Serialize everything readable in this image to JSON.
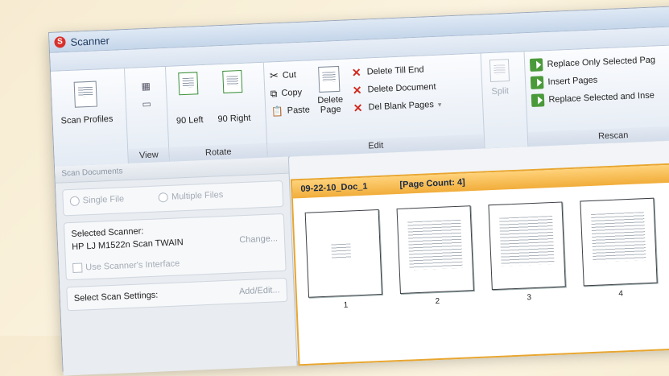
{
  "window": {
    "title": "Scanner"
  },
  "ribbon": {
    "groups": {
      "scan_profiles": {
        "button": "Scan Profiles"
      },
      "view": {
        "label": "View"
      },
      "rotate": {
        "label": "Rotate",
        "left": "90 Left",
        "right": "90 Right"
      },
      "edit": {
        "label": "Edit",
        "cut": "Cut",
        "copy": "Copy",
        "paste": "Paste",
        "delete_page_line1": "Delete",
        "delete_page_line2": "Page",
        "delete_till_end": "Delete Till End",
        "delete_document": "Delete Document",
        "del_blank_pages": "Del Blank Pages"
      },
      "split": {
        "button": "Split"
      },
      "rescan": {
        "label": "Rescan",
        "replace_only_selected": "Replace Only Selected Pag",
        "insert_pages": "Insert Pages",
        "replace_selected_and_insert": "Replace Selected and Inse"
      }
    }
  },
  "left_panel": {
    "header": "Scan Documents",
    "single_file": "Single File",
    "multiple_files": "Multiple Files",
    "selected_scanner_label": "Selected Scanner:",
    "selected_scanner_value": "HP LJ M1522n Scan TWAIN",
    "change_link": "Change...",
    "use_interface": "Use Scanner's Interface",
    "select_settings_label": "Select Scan Settings:",
    "add_edit_link": "Add/Edit..."
  },
  "document": {
    "name": "09-22-10_Doc_1",
    "page_count": "[Page Count: 4]",
    "pages": [
      "1",
      "2",
      "3",
      "4"
    ]
  }
}
